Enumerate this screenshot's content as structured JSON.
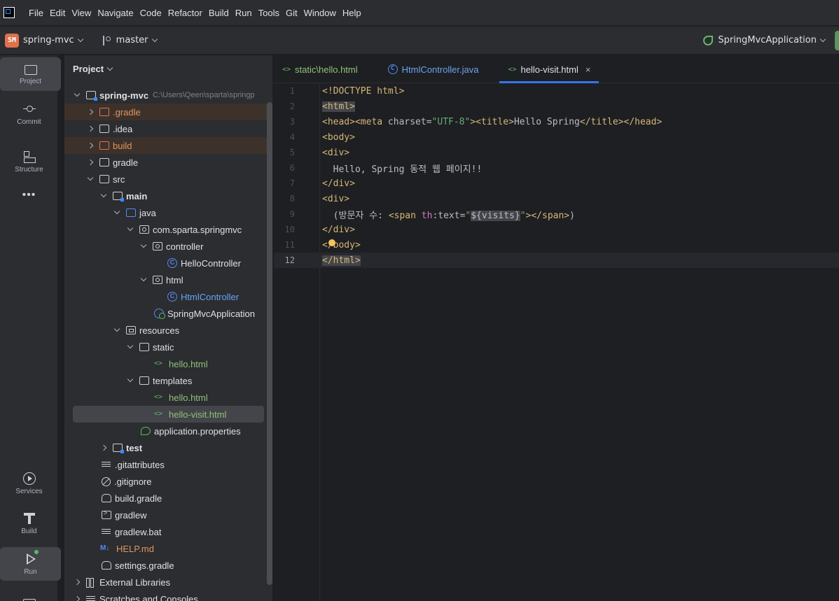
{
  "menu": {
    "items": [
      "File",
      "Edit",
      "View",
      "Navigate",
      "Code",
      "Refactor",
      "Build",
      "Run",
      "Tools",
      "Git",
      "Window",
      "Help"
    ]
  },
  "toolbar": {
    "project_badge": "SM",
    "project_name": "spring-mvc",
    "branch": "master",
    "run_config": "SpringMvcApplication"
  },
  "left_tools": {
    "project": "Project",
    "commit": "Commit",
    "structure": "Structure",
    "more": "•••",
    "services": "Services",
    "build": "Build",
    "run": "Run"
  },
  "project_panel": {
    "title": "Project",
    "root_name": "spring-mvc",
    "root_path": "C:\\Users\\Qeen\\sparta\\springp",
    "items": [
      {
        "label": ".gradle"
      },
      {
        "label": ".idea"
      },
      {
        "label": "build"
      },
      {
        "label": "gradle"
      },
      {
        "label": "src"
      },
      {
        "label": "main"
      },
      {
        "label": "java"
      },
      {
        "label": "com.sparta.springmvc"
      },
      {
        "label": "controller"
      },
      {
        "label": "HelloController"
      },
      {
        "label": "html"
      },
      {
        "label": "HtmlController"
      },
      {
        "label": "SpringMvcApplication"
      },
      {
        "label": "resources"
      },
      {
        "label": "static"
      },
      {
        "label": "hello.html"
      },
      {
        "label": "templates"
      },
      {
        "label": "hello.html"
      },
      {
        "label": "hello-visit.html"
      },
      {
        "label": "application.properties"
      },
      {
        "label": "test"
      },
      {
        "label": ".gitattributes"
      },
      {
        "label": ".gitignore"
      },
      {
        "label": "build.gradle"
      },
      {
        "label": "gradlew"
      },
      {
        "label": "gradlew.bat"
      },
      {
        "label": "HELP.md"
      },
      {
        "label": "settings.gradle"
      },
      {
        "label": "External Libraries"
      },
      {
        "label": "Scratches and Consoles"
      }
    ]
  },
  "tabs": [
    {
      "label": "static\\hello.html"
    },
    {
      "label": "HtmlController.java"
    },
    {
      "label": "hello-visit.html"
    }
  ],
  "icons": {
    "html_icon": "<>",
    "class_icon": "C",
    "close_icon": "×",
    "md_icon": "M↓"
  },
  "code": {
    "line_numbers": [
      "1",
      "2",
      "3",
      "4",
      "5",
      "6",
      "7",
      "8",
      "9",
      "10",
      "11",
      "12"
    ],
    "l1": "<!DOCTYPE html>",
    "l2": "<html>",
    "l3_a": "<head><meta ",
    "l3_b": "charset=",
    "l3_c": "\"UTF-8\"",
    "l3_d": "><title>",
    "l3_e": "Hello Spring",
    "l3_f": "</title></head>",
    "l4": "<body>",
    "l5": "<div>",
    "l6": "  Hello, Spring 동적 웹 페이지!!",
    "l7": "</div>",
    "l8": "<div>",
    "l9_a": "  (방문자 수: ",
    "l9_b": "<span ",
    "l9_c": "th",
    "l9_d": ":text=",
    "l9_e": "\"",
    "l9_f": "${visits}",
    "l9_g": "\"",
    "l9_h": "></span>",
    "l9_i": ")",
    "l10": "</div>",
    "l11": "</body>",
    "l12": "</html>"
  },
  "colors": {
    "accent": "#3574f0",
    "background": "#1e1f22",
    "panel": "#2b2d30"
  }
}
